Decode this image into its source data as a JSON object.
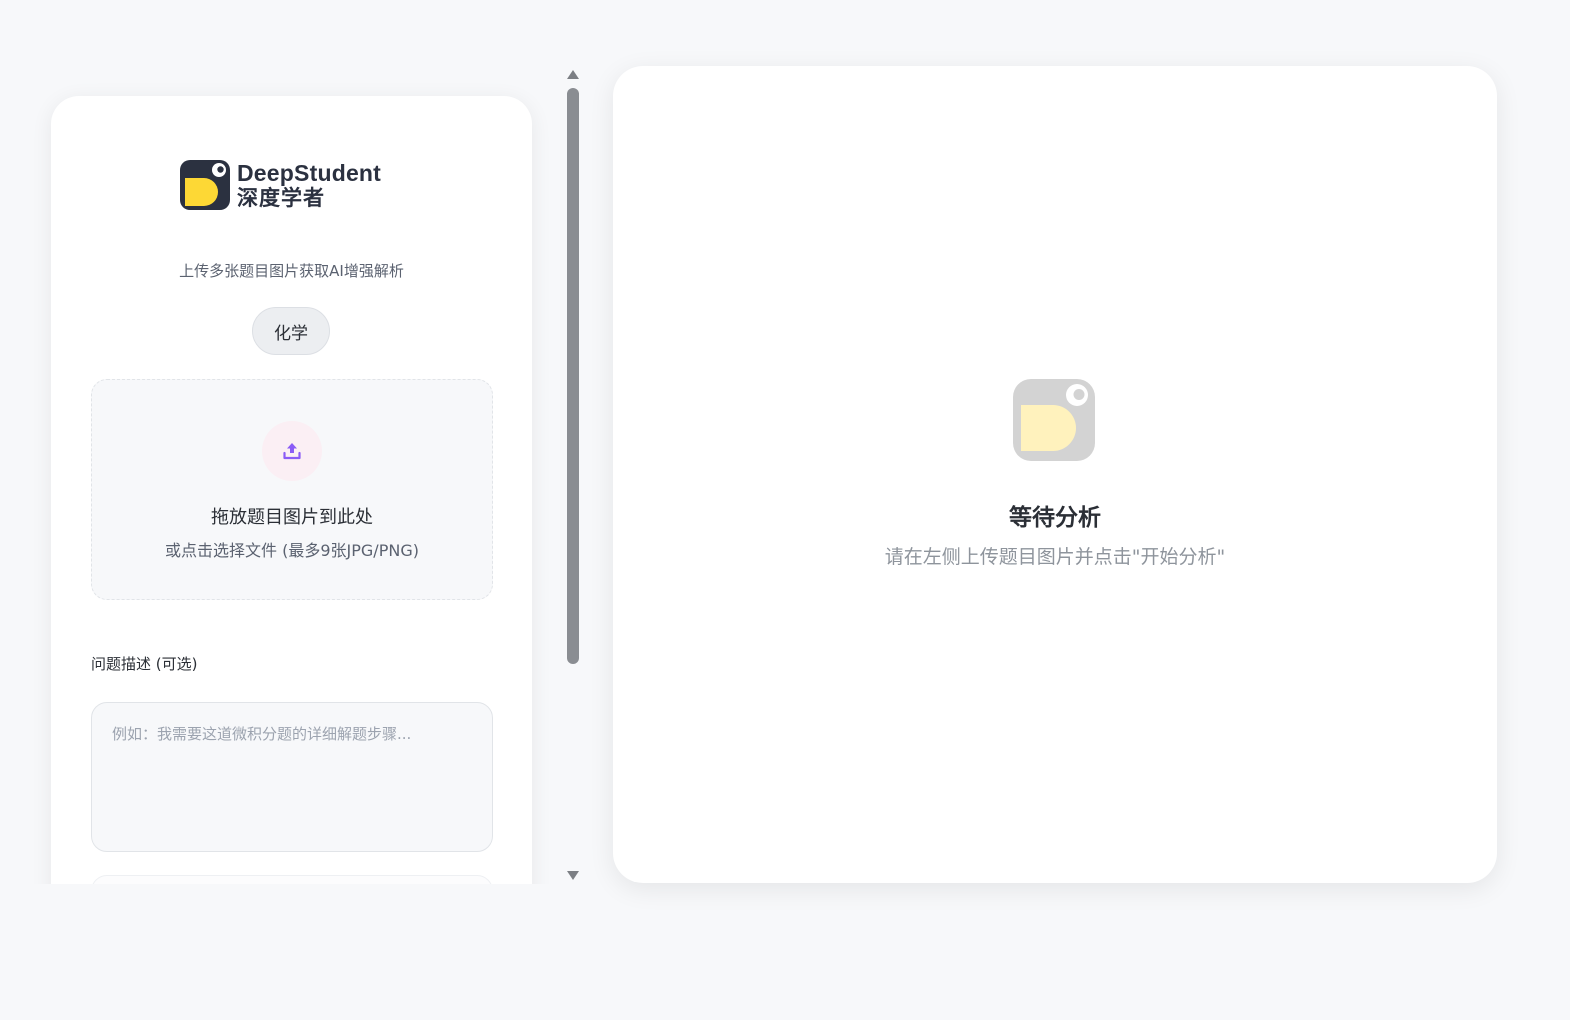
{
  "brand": {
    "name_en": "DeepStudent",
    "name_zh": "深度学者",
    "colors": {
      "dark": "#2b3140",
      "yellow": "#fdd835"
    }
  },
  "left_panel": {
    "subtitle": "上传多张题目图片获取AI增强解析",
    "subject": "化学",
    "dropzone": {
      "icon": "upload-icon",
      "title": "拖放题目图片到此处",
      "subtitle": "或点击选择文件 (最多9张JPG/PNG)"
    },
    "description": {
      "label": "问题描述 (可选)",
      "value": "",
      "placeholder": "例如：我需要这道微积分题的详细解题步骤..."
    }
  },
  "right_panel": {
    "icon": "placeholder-logo-icon",
    "title": "等待分析",
    "subtitle": "请在左侧上传题目图片并点击\"开始分析\""
  }
}
